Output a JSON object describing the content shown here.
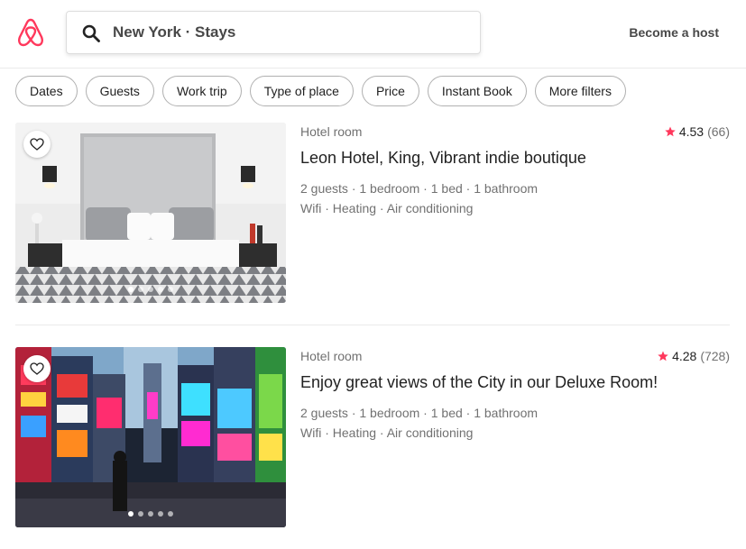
{
  "header": {
    "search_text": "New York · Stays",
    "host_label": "Become a host",
    "brand_color": "#FF385C"
  },
  "filters": [
    "Dates",
    "Guests",
    "Work trip",
    "Type of place",
    "Price",
    "Instant Book",
    "More filters"
  ],
  "listings": [
    {
      "type": "Hotel room",
      "rating": "4.53",
      "reviews": "(66)",
      "title": "Leon Hotel, King, Vibrant indie boutique",
      "specs": "2 guests · 1 bedroom · 1 bed · 1 bathroom",
      "amenities": "Wifi · Heating · Air conditioning",
      "photo_dots": 5,
      "active_dot": 0
    },
    {
      "type": "Hotel room",
      "rating": "4.28",
      "reviews": "(728)",
      "title": "Enjoy great views of the City in our Deluxe Room!",
      "specs": "2 guests · 1 bedroom · 1 bed · 1 bathroom",
      "amenities": "Wifi · Heating · Air conditioning",
      "photo_dots": 5,
      "active_dot": 0
    }
  ],
  "icons": {
    "logo": "airbnb-logo-icon",
    "search": "search-icon",
    "save": "heart-icon",
    "rating": "star-icon"
  }
}
